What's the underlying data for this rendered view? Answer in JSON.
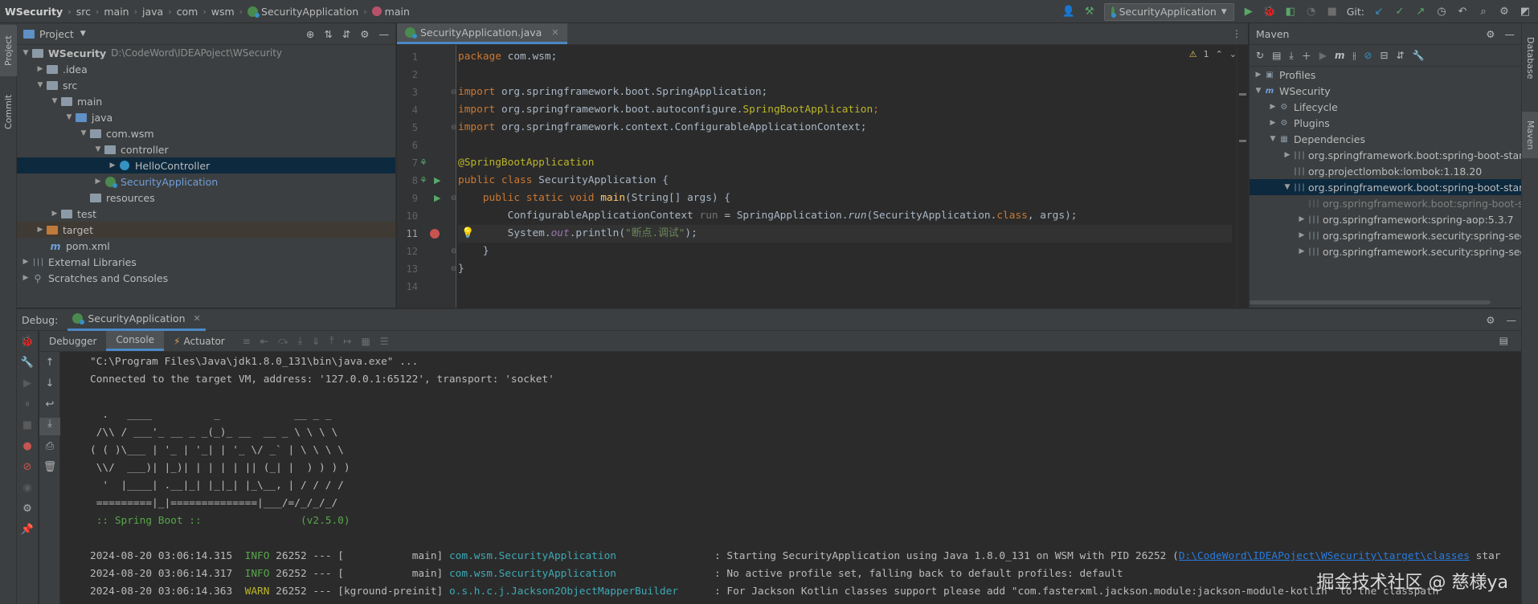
{
  "breadcrumb": [
    "WSecurity",
    "src",
    "main",
    "java",
    "com",
    "wsm",
    "SecurityApplication",
    "main"
  ],
  "toolbar": {
    "run_config": "SecurityApplication",
    "git_label": "Git:"
  },
  "left_stripe": {
    "project_tab": "Project",
    "commit_tab": "Commit"
  },
  "right_stripe": {
    "database_tab": "Database",
    "maven_tab": "Maven"
  },
  "project": {
    "title": "Project",
    "root_label": "WSecurity",
    "root_path": "D:\\CodeWord\\IDEAPoject\\WSecurity",
    "items": [
      {
        "label": "WSecurity"
      },
      {
        "label": ".idea"
      },
      {
        "label": "src"
      },
      {
        "label": "main"
      },
      {
        "label": "java"
      },
      {
        "label": "com.wsm"
      },
      {
        "label": "controller"
      },
      {
        "label": "HelloController"
      },
      {
        "label": "SecurityApplication"
      },
      {
        "label": "resources"
      },
      {
        "label": "test"
      },
      {
        "label": "target"
      },
      {
        "label": "pom.xml"
      },
      {
        "label": "External Libraries"
      },
      {
        "label": "Scratches and Consoles"
      }
    ]
  },
  "editor": {
    "tab_label": "SecurityApplication.java",
    "warning_count": "1",
    "line_numbers": [
      "1",
      "2",
      "3",
      "4",
      "5",
      "6",
      "7",
      "8",
      "9",
      "10",
      "11",
      "12",
      "13",
      "14"
    ],
    "lines": {
      "l1": {
        "a": "package",
        "b": " com.wsm;"
      },
      "l3": {
        "a": "import",
        "b": " org.springframework.boot.SpringApplication;"
      },
      "l4": {
        "a": "import",
        "b": " org.springframework.boot.autoconfigure.",
        "c": "SpringBootApplication",
        "d": ";"
      },
      "l5": {
        "a": "import",
        "b": " org.springframework.context.ConfigurableApplicationContext;"
      },
      "l7": {
        "a": "@SpringBootApplication"
      },
      "l8": {
        "a": "public class",
        "b": " SecurityApplication {"
      },
      "l9": {
        "a": "    public static void ",
        "b": "main",
        "c": "(String[] args) {"
      },
      "l10": {
        "a": "        ConfigurableApplicationContext ",
        "b": "run",
        "c": " = SpringApplication.",
        "d": "run",
        "e": "(SecurityApplication.",
        "f": "class",
        "g": ", args);"
      },
      "l11": {
        "a": "        System.",
        "b": "out",
        "c": ".println(",
        "d": "\"断点.调试\"",
        "e": ");"
      },
      "l12": {
        "a": "    }"
      },
      "l13": {
        "a": "}"
      }
    }
  },
  "maven": {
    "title": "Maven",
    "items": [
      {
        "label": "Profiles"
      },
      {
        "label": "WSecurity"
      },
      {
        "label": "Lifecycle"
      },
      {
        "label": "Plugins"
      },
      {
        "label": "Dependencies"
      },
      {
        "label": "org.springframework.boot:spring-boot-starter"
      },
      {
        "label": "org.projectlombok:lombok:1.18.20"
      },
      {
        "label": "org.springframework.boot:spring-boot-starter"
      },
      {
        "label": "org.springframework.boot:spring-boot-star"
      },
      {
        "label": "org.springframework:spring-aop:5.3.7"
      },
      {
        "label": "org.springframework.security:spring-securit"
      },
      {
        "label": "org.springframework.security:spring-securit"
      }
    ]
  },
  "debug": {
    "title": "Debug:",
    "run_tab": "SecurityApplication",
    "tabs": [
      "Debugger",
      "Console",
      "Actuator"
    ],
    "console": {
      "lines": [
        "\"C:\\Program Files\\Java\\jdk1.8.0_131\\bin\\java.exe\" ...",
        "Connected to the target VM, address: '127.0.0.1:65122', transport: 'socket'"
      ],
      "banner": [
        "  .   ____          _            __ _ _",
        " /\\\\ / ___'_ __ _ _(_)_ __  __ _ \\ \\ \\ \\",
        "( ( )\\___ | '_ | '_| | '_ \\/ _` | \\ \\ \\ \\",
        " \\\\/  ___)| |_)| | | | | || (_| |  ) ) ) )",
        "  '  |____| .__|_| |_|_| |_\\__, | / / / /",
        " =========|_|==============|___/=/_/_/_/"
      ],
      "spring_line": " :: Spring Boot ::                (v2.5.0)",
      "logs": [
        {
          "ts": "2024-08-20 03:06:14.315",
          "level": "INFO",
          "pid": "26252",
          "sep": "---",
          "thread": "[           main]",
          "logger": "com.wsm.SecurityApplication",
          "msg": ": Starting SecurityApplication using Java 1.8.0_131 on WSM with PID 26252 (",
          "link": "D:\\CodeWord\\IDEAPoject\\WSecurity\\target\\classes",
          "tail": " star"
        },
        {
          "ts": "2024-08-20 03:06:14.317",
          "level": "INFO",
          "pid": "26252",
          "sep": "---",
          "thread": "[           main]",
          "logger": "com.wsm.SecurityApplication",
          "msg": ": No active profile set, falling back to default profiles: default"
        },
        {
          "ts": "2024-08-20 03:06:14.363",
          "level": "WARN",
          "pid": "26252",
          "sep": "---",
          "thread": "[kground-preinit]",
          "logger": "o.s.h.c.j.Jackson2ObjectMapperBuilder",
          "msg": ": For Jackson Kotlin classes support please add \"com.fasterxml.jackson.module:jackson-module-kotlin\" to the classpath"
        }
      ]
    }
  },
  "watermark": "掘金技术社区 @ 慈様ya",
  "colors": {
    "background": "#2b2b2b",
    "panel": "#3c3f41",
    "selection": "#0d293e",
    "keyword": "#cc7832",
    "annotation": "#bbb529",
    "string": "#6a8759",
    "breakpoint": "#c75450",
    "accent": "#4a88c7"
  }
}
